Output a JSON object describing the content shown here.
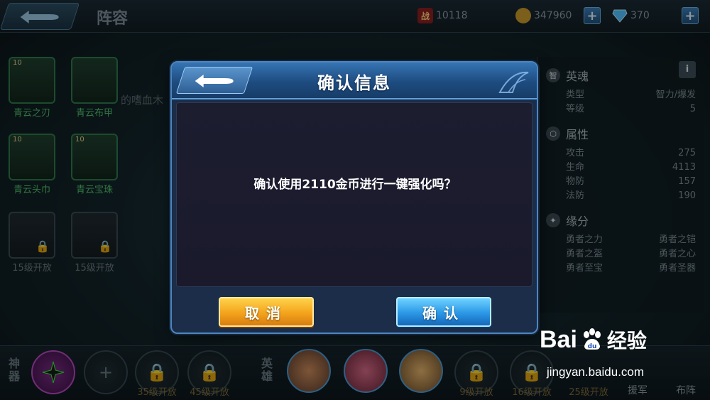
{
  "topbar": {
    "title": "阵容",
    "battle_icon": "战",
    "battle_power": "10118",
    "gold": "347960",
    "diamonds": "370",
    "plus": "+"
  },
  "equipment": [
    {
      "level": "10",
      "name": "青云之刃",
      "locked": false
    },
    {
      "level": "",
      "name": "青云布甲",
      "locked": false
    },
    {
      "level": "10",
      "name": "青云头巾",
      "locked": false
    },
    {
      "level": "10",
      "name": "青云宝珠",
      "locked": false
    },
    {
      "level": "",
      "name": "15级开放",
      "locked": true
    },
    {
      "level": "",
      "name": "15级开放",
      "locked": true
    }
  ],
  "side_text": "的嗜血木",
  "info_panel": {
    "section_soul": "英魂",
    "soul_icon": "智",
    "info_button": "i",
    "type_label": "类型",
    "type_value": "智力/爆发",
    "level_label": "等级",
    "level_value": "5",
    "section_attr": "属性",
    "attrs": [
      {
        "label": "攻击",
        "value": "275"
      },
      {
        "label": "生命",
        "value": "4113"
      },
      {
        "label": "物防",
        "value": "157"
      },
      {
        "label": "法防",
        "value": "190"
      }
    ],
    "section_fate": "缘分",
    "fates": [
      [
        "勇者之力",
        "勇者之铠"
      ],
      [
        "勇者之盔",
        "勇者之心"
      ],
      [
        "勇者至宝",
        "勇者圣器"
      ]
    ]
  },
  "bottombar": {
    "artifact_tag": "神器",
    "hero_tag": "英雄",
    "unlock_35": "35级开放",
    "unlock_45": "45级开放",
    "unlock_9": "9级开放",
    "unlock_16": "16级开放",
    "unlock_25": "25级开放",
    "aid_label": "援军",
    "formation_label": "布阵"
  },
  "dialog": {
    "title": "确认信息",
    "message": "确认使用2110金币进行一键强化吗？",
    "cancel": "取消",
    "confirm": "确认"
  },
  "watermark": {
    "brand": "Bai",
    "brand_cn": "经验",
    "url": "jingyan.baidu.com"
  },
  "colors": {
    "cancel_button": "#f3a31c",
    "confirm_button": "#2a97e6",
    "dialog_header": "#1e4c80",
    "green_label": "#4fbf6a"
  }
}
